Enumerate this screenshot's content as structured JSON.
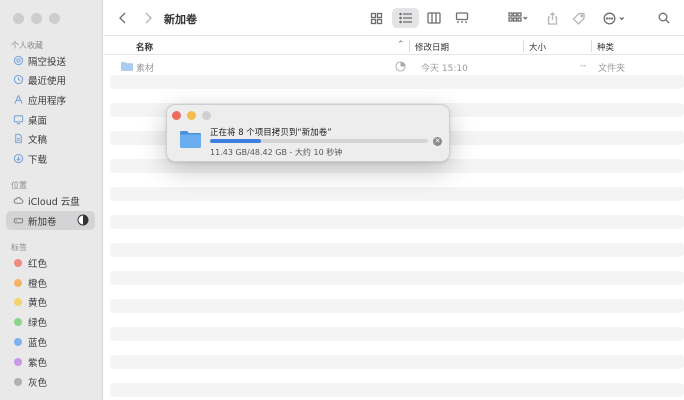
{
  "window": {
    "title": "新加卷"
  },
  "sidebar": {
    "favorites_title": "个人收藏",
    "favorites": [
      {
        "label": "隔空投送",
        "icon": "airdrop-icon"
      },
      {
        "label": "最近使用",
        "icon": "clock-icon"
      },
      {
        "label": "应用程序",
        "icon": "applications-icon"
      },
      {
        "label": "桌面",
        "icon": "desktop-icon"
      },
      {
        "label": "文稿",
        "icon": "document-icon"
      },
      {
        "label": "下载",
        "icon": "download-icon"
      }
    ],
    "locations_title": "位置",
    "locations": [
      {
        "label": "iCloud 云盘",
        "icon": "cloud-icon"
      },
      {
        "label": "新加卷",
        "icon": "drive-icon",
        "selected": true
      }
    ],
    "tags_title": "标签",
    "tags": [
      {
        "label": "红色",
        "color": "#f08a86"
      },
      {
        "label": "橙色",
        "color": "#f5b36a"
      },
      {
        "label": "黄色",
        "color": "#f2d46a"
      },
      {
        "label": "绿色",
        "color": "#8fd48c"
      },
      {
        "label": "蓝色",
        "color": "#7eb1ee"
      },
      {
        "label": "紫色",
        "color": "#c69ae6"
      },
      {
        "label": "灰色",
        "color": "#b0b0b3"
      }
    ]
  },
  "columns": {
    "name": "名称",
    "date": "修改日期",
    "size": "大小",
    "kind": "种类"
  },
  "files": [
    {
      "name": "素材",
      "date": "今天 15:10",
      "size": "--",
      "kind": "文件夹"
    }
  ],
  "copy_dialog": {
    "title": "正在将 8 个项目拷贝到“新加卷”",
    "status": "11.43 GB/48.42 GB - 大约 10 秒钟",
    "progress": 0.236,
    "accent": "#3f7fe0"
  }
}
